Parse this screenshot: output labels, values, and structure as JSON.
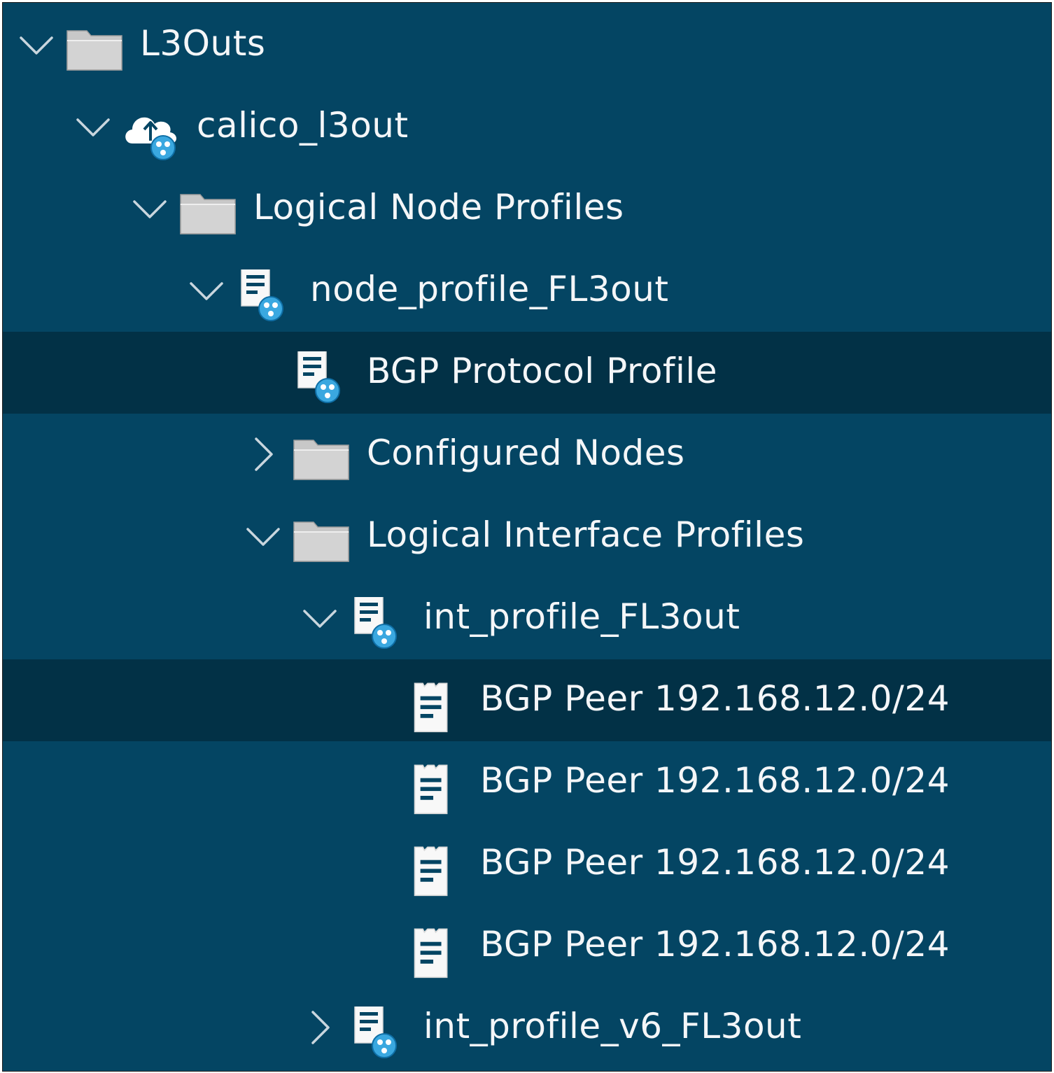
{
  "tree": {
    "nodes": [
      {
        "label": "L3Outs",
        "chevron": "expanded",
        "icon": "folder-icon",
        "level": 0,
        "selected": false
      },
      {
        "label": "calico_l3out",
        "chevron": "expanded",
        "icon": "cloud-upload-icon",
        "level": 1,
        "selected": false
      },
      {
        "label": "Logical Node Profiles",
        "chevron": "expanded",
        "icon": "folder-icon",
        "level": 2,
        "selected": false
      },
      {
        "label": "node_profile_FL3out",
        "chevron": "expanded",
        "icon": "profile-document-icon",
        "level": 3,
        "selected": false
      },
      {
        "label": "BGP Protocol Profile",
        "chevron": "none",
        "icon": "profile-document-icon",
        "level": 4,
        "selected": true
      },
      {
        "label": "Configured Nodes",
        "chevron": "collapsed",
        "icon": "folder-icon",
        "level": 4,
        "selected": false
      },
      {
        "label": "Logical Interface Profiles",
        "chevron": "expanded",
        "icon": "folder-icon",
        "level": 4,
        "selected": false
      },
      {
        "label": "int_profile_FL3out",
        "chevron": "expanded",
        "icon": "profile-document-icon",
        "level": 5,
        "selected": false
      },
      {
        "label": "BGP Peer 192.168.12.0/24",
        "chevron": "none",
        "icon": "document-icon",
        "level": 6,
        "selected": true
      },
      {
        "label": "BGP Peer 192.168.12.0/24",
        "chevron": "none",
        "icon": "document-icon",
        "level": 6,
        "selected": false
      },
      {
        "label": "BGP Peer 192.168.12.0/24",
        "chevron": "none",
        "icon": "document-icon",
        "level": 6,
        "selected": false
      },
      {
        "label": "BGP Peer 192.168.12.0/24",
        "chevron": "none",
        "icon": "document-icon",
        "level": 6,
        "selected": false
      },
      {
        "label": "int_profile_v6_FL3out",
        "chevron": "collapsed",
        "icon": "profile-document-icon",
        "level": 5,
        "selected": false
      }
    ]
  },
  "colors": {
    "panel_background": "#044563",
    "selected_row": "#023146",
    "folder_fill": "#c8c8c8",
    "badge_blue": "#3aa8e0"
  }
}
